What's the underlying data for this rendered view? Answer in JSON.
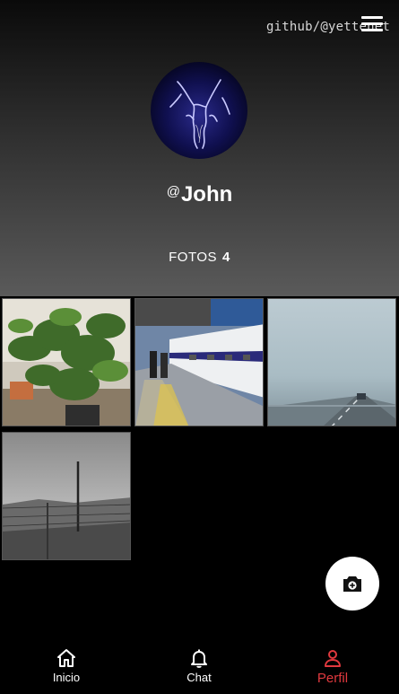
{
  "header": {
    "github_handle": "github/@yettenet",
    "menu_icon": "menu-icon",
    "avatar_icon": "lightning-avatar-image",
    "username_prefix": "@",
    "username": "John",
    "photos_label": "FOTOS",
    "photos_count": "4"
  },
  "photos": [
    {
      "name": "photo-plants",
      "subject": "potted plants"
    },
    {
      "name": "photo-train-station",
      "subject": "train platform"
    },
    {
      "name": "photo-foggy-road",
      "subject": "foggy road"
    },
    {
      "name": "photo-fence",
      "subject": "fence field"
    }
  ],
  "fab": {
    "icon": "add-photo-icon"
  },
  "nav": {
    "items": [
      {
        "label": "Inicio",
        "icon": "home-icon"
      },
      {
        "label": "Chat",
        "icon": "bell-icon"
      },
      {
        "label": "Perfil",
        "icon": "person-icon"
      }
    ],
    "active_color": "#e0393e"
  }
}
